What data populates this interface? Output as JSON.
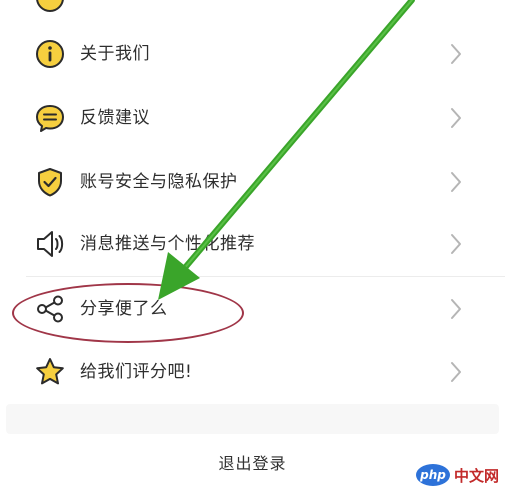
{
  "menu": {
    "items": [
      {
        "label": "关于我们",
        "icon": "info-icon"
      },
      {
        "label": "反馈建议",
        "icon": "chat-bubble-icon"
      },
      {
        "label": "账号安全与隐私保护",
        "icon": "shield-check-icon"
      },
      {
        "label": "消息推送与个性化推荐",
        "icon": "speaker-icon"
      },
      {
        "label": "分享便了么",
        "icon": "share-icon"
      },
      {
        "label": "给我们评分吧!",
        "icon": "star-icon"
      }
    ]
  },
  "logout": {
    "label": "退出登录"
  },
  "annotation": {
    "highlight_target": "分享便了么",
    "ellipse_color": "#a03648",
    "arrow_color": "#3aa52a"
  },
  "watermark": {
    "badge": "php",
    "site": "中文网"
  },
  "colors": {
    "icon_fill": "#f6cf3f",
    "icon_stroke": "#2b2b2b",
    "chevron": "#b5b5b5",
    "text": "#2e2e2e"
  }
}
